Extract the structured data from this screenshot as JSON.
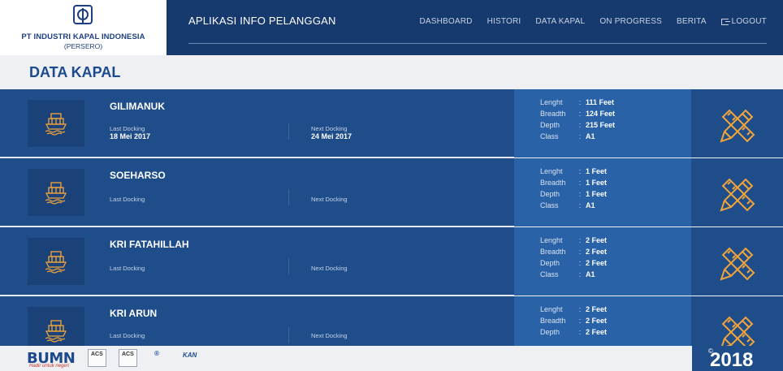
{
  "brand": {
    "name": "PT INDUSTRI KAPAL INDONESIA",
    "sub": "(PERSERO)"
  },
  "header": {
    "app_title": "APLIKASI INFO PELANGGAN",
    "nav": [
      "DASHBOARD",
      "HISTORI",
      "DATA KAPAL",
      "ON PROGRESS",
      "BERITA"
    ],
    "logout": "LOGOUT"
  },
  "page": {
    "title": "DATA KAPAL"
  },
  "labels": {
    "last_docking": "Last Docking",
    "next_docking": "Next Docking",
    "length": "Lenght",
    "breadth": "Breadth",
    "depth": "Depth",
    "class": "Class",
    "separator": ":"
  },
  "ships": [
    {
      "name": "GILIMANUK",
      "last_docking": "18 Mei 2017",
      "next_docking": "24 Mei 2017",
      "length": "111 Feet",
      "breadth": "124 Feet",
      "depth": "215 Feet",
      "class": "A1"
    },
    {
      "name": "SOEHARSO",
      "last_docking": "",
      "next_docking": "",
      "length": "1 Feet",
      "breadth": "1 Feet",
      "depth": "1 Feet",
      "class": "A1"
    },
    {
      "name": "KRI FATAHILLAH",
      "last_docking": "",
      "next_docking": "",
      "length": "2 Feet",
      "breadth": "2 Feet",
      "depth": "2 Feet",
      "class": "A1"
    },
    {
      "name": "KRI ARUN",
      "last_docking": "",
      "next_docking": "",
      "length": "2 Feet",
      "breadth": "2 Feet",
      "depth": "2 Feet",
      "class": ""
    }
  ],
  "footer": {
    "bumn": "BUMN",
    "bumn_tag": "Hadir untuk negeri",
    "cert1": "ACS",
    "cert2": "ACS",
    "kan": "KAN",
    "year": "2018",
    "copyright": "©"
  },
  "icons": {
    "ship": "ship-icon",
    "edit": "pencil-ruler-icon",
    "logout": "logout-icon",
    "logo": "iki-logo-icon"
  },
  "colors": {
    "navy": "#163a6e",
    "card": "#1e4d8a",
    "specs": "#2a62a8",
    "accent": "#f0a43a",
    "title": "#1d4a8f"
  }
}
